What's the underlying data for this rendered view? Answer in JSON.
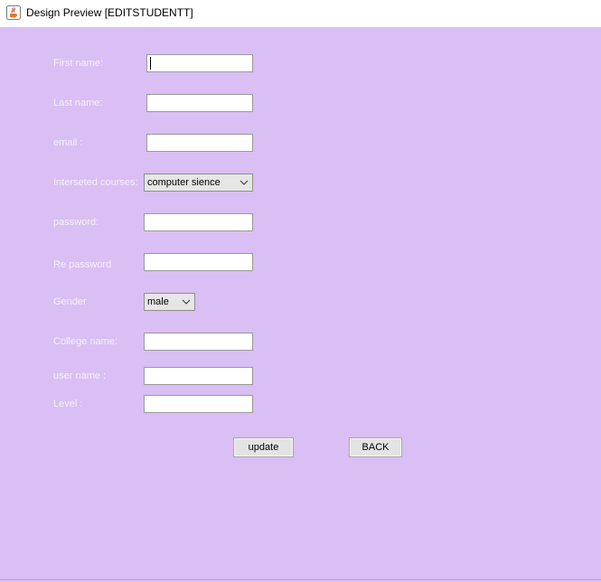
{
  "window": {
    "title": "Design Preview [EDITSTUDENTT]"
  },
  "form": {
    "first_name": {
      "label": "First name:",
      "value": ""
    },
    "last_name": {
      "label": "Last name:",
      "value": ""
    },
    "email": {
      "label": "email :",
      "value": ""
    },
    "interested_courses": {
      "label": "Interseted courses:",
      "selected": "computer sience"
    },
    "password": {
      "label": "password:",
      "value": ""
    },
    "re_password": {
      "label": "Re password",
      "value": ""
    },
    "gender": {
      "label": "Gender",
      "selected": "male"
    },
    "college_name": {
      "label": "College name:",
      "value": ""
    },
    "user_name": {
      "label": "user name :",
      "value": ""
    },
    "level": {
      "label": "Level :",
      "value": ""
    }
  },
  "buttons": {
    "update_label": "update",
    "back_label": "BACK"
  },
  "colors": {
    "background": "#d9bff4",
    "label_text": "#f6f0fb"
  },
  "icons": {
    "app": "java-coffee-cup-icon",
    "dropdown": "chevron-down-icon"
  }
}
